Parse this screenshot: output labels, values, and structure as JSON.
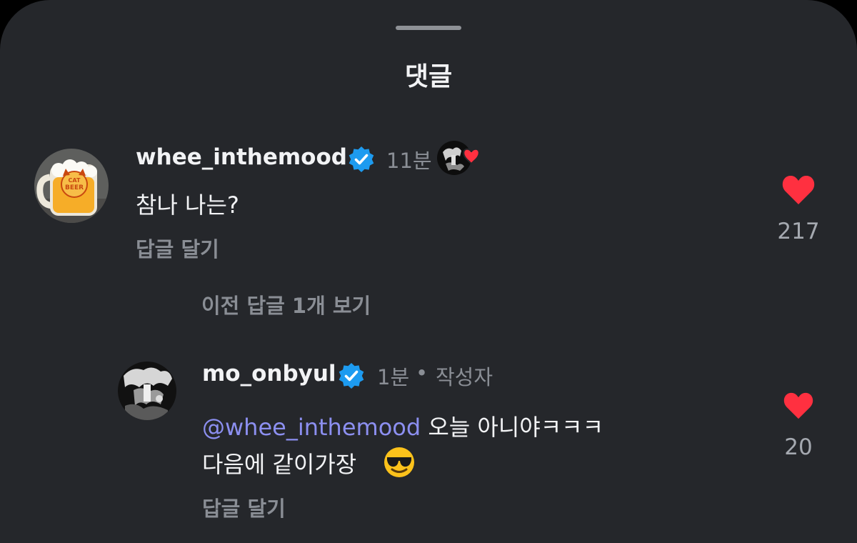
{
  "sheet": {
    "title": "댓글"
  },
  "comments": [
    {
      "username": "whee_inthemood",
      "verified": true,
      "time": "11분",
      "text": "참나 나는?",
      "reply_label": "답글 달기",
      "likes": "217",
      "liked_by_author": true
    }
  ],
  "view_previous_label": "이전 답글 1개 보기",
  "replies": [
    {
      "username": "mo_onbyul",
      "verified": true,
      "time": "1분",
      "separator": "•",
      "author_badge": "작성자",
      "mention": "@whee_inthemood",
      "text_line1": " 오늘 아니야ㅋㅋㅋ",
      "text_line2": "다음에 같이가장",
      "emoji": "smiling-face-with-sunglasses",
      "reply_label": "답글 달기",
      "likes": "20"
    }
  ],
  "colors": {
    "background": "#25272b",
    "text": "#f2f3f5",
    "muted": "#8a8e95",
    "mention": "#8c8ff0",
    "heart": "#ff3040",
    "verified": "#1d9bf0"
  },
  "avatar_print_text": [
    "CAT",
    "BEER"
  ]
}
